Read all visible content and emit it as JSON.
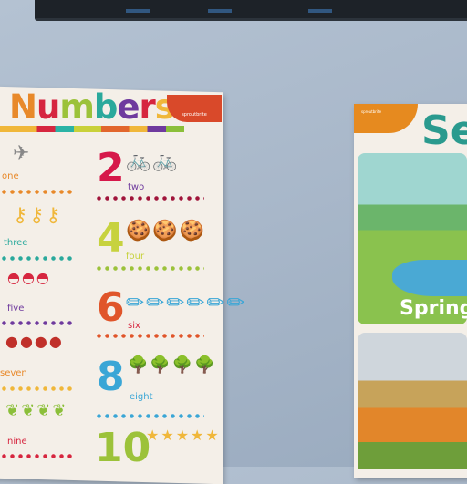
{
  "numbers_poster": {
    "title_letters": [
      "N",
      "u",
      "m",
      "b",
      "e",
      "r",
      "s"
    ],
    "title_colors": [
      "#e8892a",
      "#d6263f",
      "#9cc23a",
      "#2aa99c",
      "#6f3a9e",
      "#d6263f",
      "#f0b73a"
    ],
    "brand": "sproutbrite",
    "left_words": [
      "one",
      "three",
      "five",
      "seven",
      "nine"
    ],
    "right_items": [
      {
        "digit": "2",
        "word": "two",
        "color": "#d6184a",
        "pic": "🚲🚲"
      },
      {
        "digit": "4",
        "word": "four",
        "color": "#c7d23e",
        "pic": "🍪🍪🍪"
      },
      {
        "digit": "6",
        "word": "six",
        "color": "#e0552a",
        "pic": "✏✏✏✏✏✏"
      },
      {
        "digit": "8",
        "word": "eight",
        "color": "#3aa6d6",
        "pic": "🌳🌳🌳🌳"
      },
      {
        "digit": "10",
        "word": "",
        "color": "#9cc23a",
        "pic": "★★★★★"
      }
    ]
  },
  "seasons_poster": {
    "title": "Se",
    "corner_text": "sproutbrite",
    "spring_label": "Spring"
  }
}
